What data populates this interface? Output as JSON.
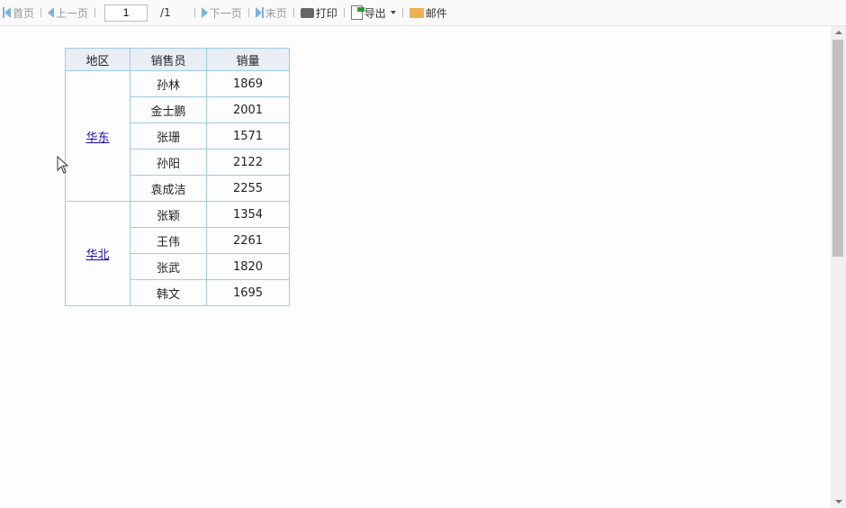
{
  "toolbar": {
    "first": "首页",
    "prev": "上一页",
    "page": "1",
    "total": "/1",
    "next": "下一页",
    "last": "末页",
    "print": "打印",
    "export": "导出",
    "mail": "邮件"
  },
  "table": {
    "headers": [
      "地区",
      "销售员",
      "销量"
    ],
    "groups": [
      {
        "region": "华东",
        "rows": [
          [
            "孙林",
            "1869"
          ],
          [
            "金士鹏",
            "2001"
          ],
          [
            "张珊",
            "1571"
          ],
          [
            "孙阳",
            "2122"
          ],
          [
            "袁成洁",
            "2255"
          ]
        ]
      },
      {
        "region": "华北",
        "rows": [
          [
            "张颖",
            "1354"
          ],
          [
            "王伟",
            "2261"
          ],
          [
            "张武",
            "1820"
          ],
          [
            "韩文",
            "1695"
          ]
        ]
      }
    ]
  },
  "colors": {
    "border": "#9fcbe8",
    "header_bg": "#e9eef5",
    "link": "#1a0dab"
  }
}
